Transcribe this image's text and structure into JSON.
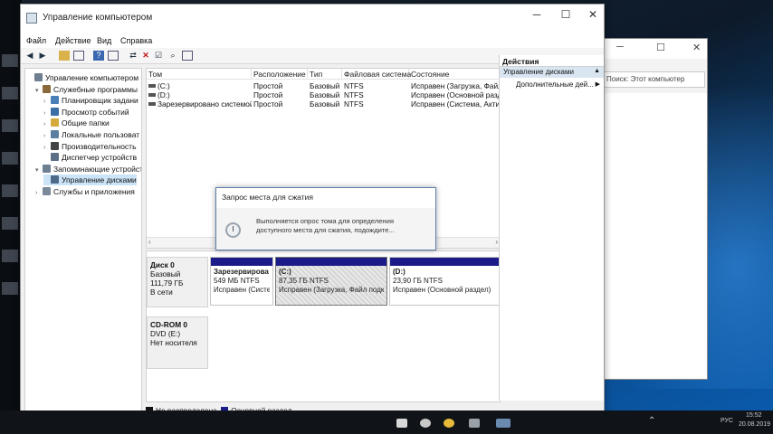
{
  "window": {
    "title": "Управление компьютером",
    "controls": {
      "minimize": "─",
      "maximize": "☐",
      "close": "✕"
    }
  },
  "menu": [
    "Файл",
    "Действие",
    "Вид",
    "Справка"
  ],
  "toolbar_icons": [
    "back-icon",
    "forward-icon",
    "up-folder-icon",
    "show-hide-tree-icon",
    "help-icon",
    "properties-icon",
    "connect-icon",
    "delete-icon",
    "check-icon",
    "search-icon",
    "new-icon"
  ],
  "tree": [
    {
      "label": "Управление компьютером (л",
      "level": 0,
      "exp": "",
      "color": "#6f7f92"
    },
    {
      "label": "Служебные программы",
      "level": 1,
      "exp": "▾",
      "color": "#8a6a3a"
    },
    {
      "label": "Планировщик задани",
      "level": 2,
      "exp": "›",
      "color": "#4a7fb8"
    },
    {
      "label": "Просмотр событий",
      "level": 2,
      "exp": "›",
      "color": "#3b6ea5"
    },
    {
      "label": "Общие папки",
      "level": 2,
      "exp": "›",
      "color": "#d6a93b"
    },
    {
      "label": "Локальные пользоват",
      "level": 2,
      "exp": "›",
      "color": "#5a7fa0"
    },
    {
      "label": "Производительность",
      "level": 2,
      "exp": "›",
      "color": "#444444"
    },
    {
      "label": "Диспетчер устройств",
      "level": 2,
      "exp": "",
      "color": "#5a6f86"
    },
    {
      "label": "Запоминающие устройст",
      "level": 1,
      "exp": "▾",
      "color": "#6f7f92"
    },
    {
      "label": "Управление дисками",
      "level": 2,
      "exp": "",
      "color": "#4d6a8a",
      "selected": true
    },
    {
      "label": "Службы и приложения",
      "level": 1,
      "exp": "›",
      "color": "#7a8a9a"
    }
  ],
  "volumes": {
    "headers": [
      "Том",
      "Расположение",
      "Тип",
      "Файловая система",
      "Состояние"
    ],
    "rows": [
      [
        "(C:)",
        "Простой",
        "Базовый",
        "NTFS",
        "Исправен (Загрузка, Файл"
      ],
      [
        "(D:)",
        "Простой",
        "Базовый",
        "NTFS",
        "Исправен (Основной разд"
      ],
      [
        "Зарезервировано системой",
        "Простой",
        "Базовый",
        "NTFS",
        "Исправен (Система, Актив"
      ]
    ]
  },
  "disks": [
    {
      "label": [
        "Диск 0",
        "Базовый",
        "111,79 ГБ",
        "В сети"
      ],
      "partitions": [
        {
          "lines": [
            "Зарезервирова",
            "549 МБ NTFS",
            "Исправен (Систе"
          ],
          "hatched": false
        },
        {
          "lines": [
            "(C:)",
            "87,35 ГБ NTFS",
            "Исправен (Загрузка, Файл подкач"
          ],
          "hatched": true
        },
        {
          "lines": [
            "(D:)",
            "23,90 ГБ NTFS",
            "Исправен (Основной раздел)"
          ],
          "hatched": false
        }
      ]
    },
    {
      "label": [
        "CD-ROM 0",
        "DVD (E:)",
        "",
        "Нет носителя"
      ],
      "partitions": []
    }
  ],
  "legend": [
    {
      "label": "Не распределена",
      "color": "#111111"
    },
    {
      "label": "Основной раздел",
      "color": "#1b1b8a"
    }
  ],
  "actions": {
    "header": "Действия",
    "section": "Управление дисками",
    "more": "Дополнительные дей..."
  },
  "dialog": {
    "title": "Запрос места для сжатия",
    "message": "Выполняется опрос тома для определения доступного места для сжатия, подождите..."
  },
  "explorer": {
    "address": "Поиск: Этот компьютер",
    "controls": {
      "minimize": "─",
      "maximize": "☐",
      "close": "✕"
    }
  },
  "taskbar": {
    "lang": "РУС",
    "time": "15:52",
    "date": "20.08.2019"
  }
}
